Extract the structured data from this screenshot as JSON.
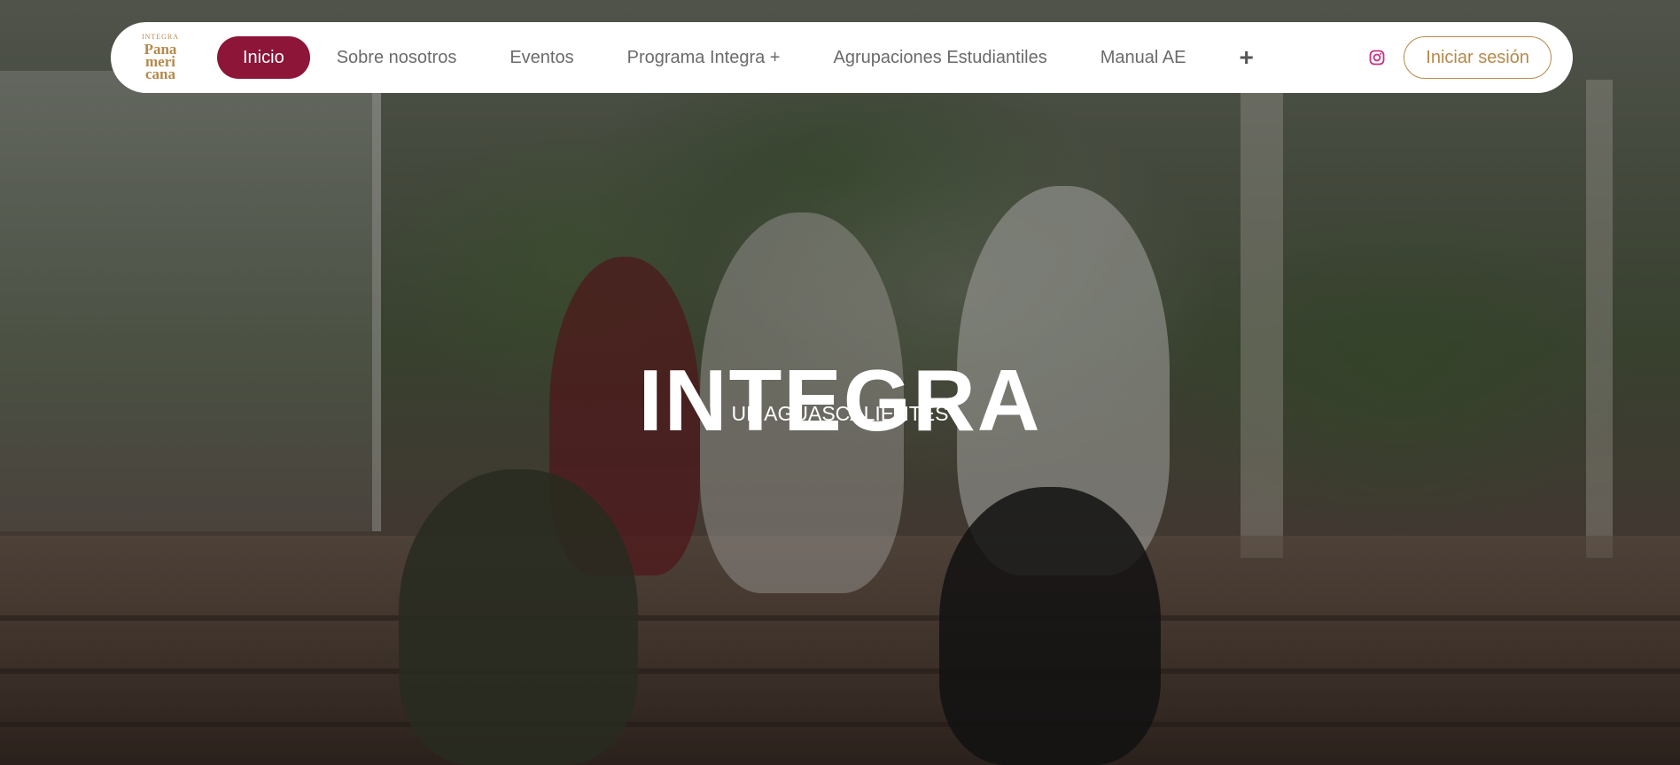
{
  "nav": {
    "logo": {
      "small": "INTEGRA",
      "lines": [
        "Pana",
        "meri",
        "cana"
      ]
    },
    "items": [
      {
        "label": "Inicio",
        "active": true
      },
      {
        "label": "Sobre nosotros",
        "active": false
      },
      {
        "label": "Eventos",
        "active": false
      },
      {
        "label": "Programa Integra +",
        "active": false
      },
      {
        "label": "Agrupaciones Estudiantiles",
        "active": false
      },
      {
        "label": "Manual AE",
        "active": false
      }
    ],
    "more_icon": "plus-icon",
    "social_icon": "instagram-icon",
    "login_label": "Iniciar sesión"
  },
  "hero": {
    "title": "INTEGRA",
    "subtitle": "UP AGUASCALIENTES"
  },
  "colors": {
    "brand_primary": "#8c1538",
    "brand_gold": "#b5894a",
    "nav_text": "#6b6b6b",
    "instagram": "#c13584"
  }
}
